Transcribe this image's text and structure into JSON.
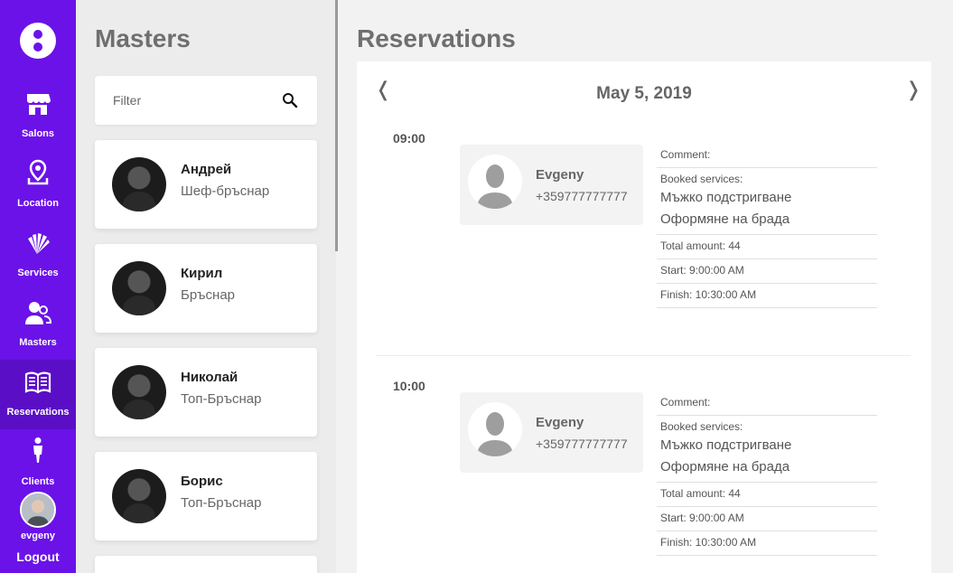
{
  "sidebar": {
    "nav": [
      {
        "label": "Salons",
        "icon": "store-icon"
      },
      {
        "label": "Location",
        "icon": "location-pin-icon"
      },
      {
        "label": "Services",
        "icon": "services-fan-icon"
      },
      {
        "label": "Masters",
        "icon": "users-icon"
      },
      {
        "label": "Reservations",
        "icon": "book-icon",
        "active": true
      },
      {
        "label": "Clients",
        "icon": "person-icon"
      }
    ],
    "username": "evgeny",
    "logout": "Logout",
    "accent_color": "#6b12e8"
  },
  "masters": {
    "title": "Masters",
    "filter_placeholder": "Filter",
    "list": [
      {
        "name": "Андрей",
        "role": "Шеф-бръснар"
      },
      {
        "name": "Кирил",
        "role": "Бръснар"
      },
      {
        "name": "Николай",
        "role": "Топ-Бръснар"
      },
      {
        "name": "Борис",
        "role": "Топ-Бръснар"
      }
    ]
  },
  "reservations": {
    "title": "Reservations",
    "date": "May 5, 2019",
    "prev": "❬",
    "next": "❭",
    "slots": [
      {
        "time": "09:00",
        "client_name": "Evgeny",
        "client_phone": "+359777777777",
        "comment_label": "Comment:",
        "services_label": "Booked services:",
        "services": [
          "Мъжко подстригване",
          "Оформяне на брада"
        ],
        "total": "Total amount: 44",
        "start": "Start: 9:00:00 AM",
        "finish": "Finish: 10:30:00 AM"
      },
      {
        "time": "10:00",
        "client_name": "Evgeny",
        "client_phone": "+359777777777",
        "comment_label": "Comment:",
        "services_label": "Booked services:",
        "services": [
          "Мъжко подстригване",
          "Оформяне на брада"
        ],
        "total": "Total amount: 44",
        "start": "Start: 9:00:00 AM",
        "finish": "Finish: 10:30:00 AM"
      }
    ]
  }
}
